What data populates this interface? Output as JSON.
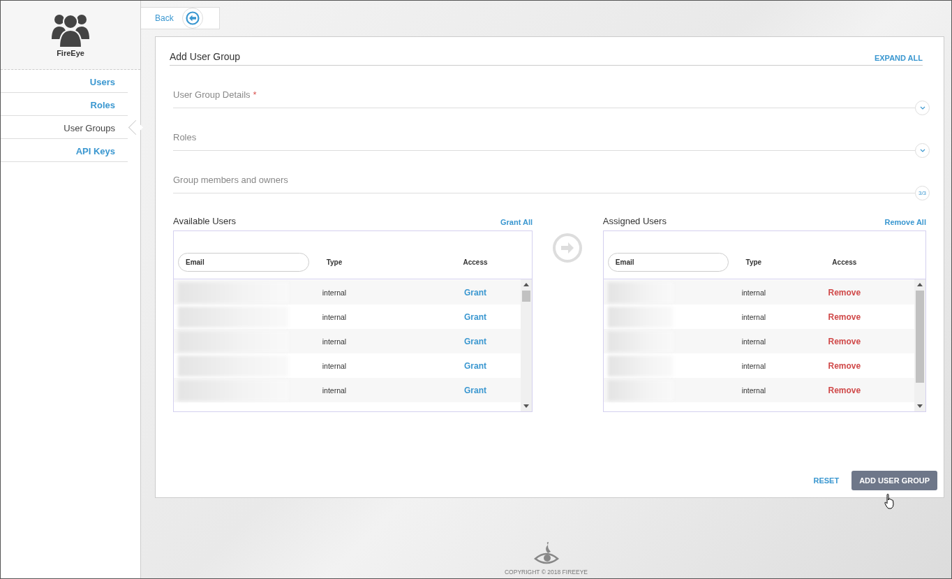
{
  "sidebar": {
    "brand": "FireEye",
    "items": [
      {
        "label": "Users",
        "selected": false
      },
      {
        "label": "Roles",
        "selected": false
      },
      {
        "label": "User Groups",
        "selected": true
      },
      {
        "label": "API Keys",
        "selected": false
      }
    ]
  },
  "back": {
    "label": "Back"
  },
  "form": {
    "title": "Add User Group",
    "expand_all": "EXPAND ALL",
    "sections": [
      {
        "title": "User Group Details",
        "required_mark": "*",
        "kind": "chevron"
      },
      {
        "title": "Roles",
        "kind": "chevron"
      },
      {
        "title": "Group members and owners",
        "kind": "count",
        "count": "3/3"
      }
    ],
    "available": {
      "title": "Available Users",
      "action": "Grant All",
      "columns": {
        "email_placeholder": "Email",
        "type": "Type",
        "access": "Access"
      },
      "rows": [
        {
          "type": "internal",
          "access": "Grant"
        },
        {
          "type": "internal",
          "access": "Grant"
        },
        {
          "type": "internal",
          "access": "Grant"
        },
        {
          "type": "internal",
          "access": "Grant"
        },
        {
          "type": "internal",
          "access": "Grant"
        }
      ]
    },
    "assigned": {
      "title": "Assigned Users",
      "action": "Remove All",
      "columns": {
        "email_placeholder": "Email",
        "type": "Type",
        "access": "Access"
      },
      "rows": [
        {
          "type": "internal",
          "access": "Remove"
        },
        {
          "type": "internal",
          "access": "Remove"
        },
        {
          "type": "internal",
          "access": "Remove"
        },
        {
          "type": "internal",
          "access": "Remove"
        },
        {
          "type": "internal",
          "access": "Remove"
        }
      ]
    },
    "buttons": {
      "reset": "RESET",
      "submit": "ADD USER GROUP"
    }
  },
  "footer": {
    "copyright": "COPYRIGHT © 2018 FIREEYE"
  }
}
